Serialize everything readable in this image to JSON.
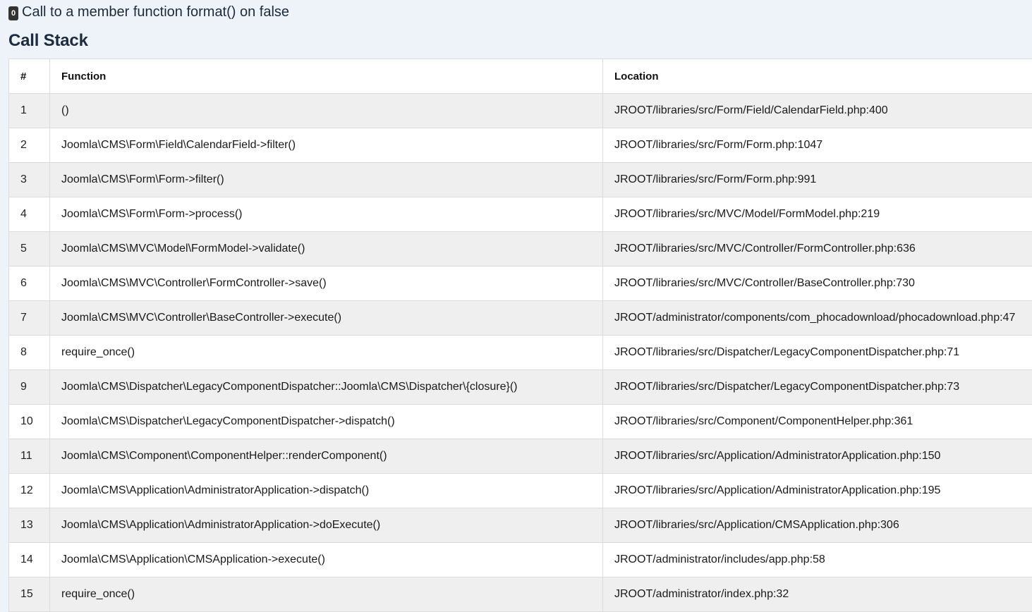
{
  "error": {
    "badge": "0",
    "message": "Call to a member function format() on false"
  },
  "call_stack": {
    "title": "Call Stack",
    "columns": [
      "#",
      "Function",
      "Location"
    ],
    "rows": [
      {
        "num": "1",
        "function": "()",
        "location": "JROOT/libraries/src/Form/Field/CalendarField.php:400"
      },
      {
        "num": "2",
        "function": "Joomla\\CMS\\Form\\Field\\CalendarField->filter()",
        "location": "JROOT/libraries/src/Form/Form.php:1047"
      },
      {
        "num": "3",
        "function": "Joomla\\CMS\\Form\\Form->filter()",
        "location": "JROOT/libraries/src/Form/Form.php:991"
      },
      {
        "num": "4",
        "function": "Joomla\\CMS\\Form\\Form->process()",
        "location": "JROOT/libraries/src/MVC/Model/FormModel.php:219"
      },
      {
        "num": "5",
        "function": "Joomla\\CMS\\MVC\\Model\\FormModel->validate()",
        "location": "JROOT/libraries/src/MVC/Controller/FormController.php:636"
      },
      {
        "num": "6",
        "function": "Joomla\\CMS\\MVC\\Controller\\FormController->save()",
        "location": "JROOT/libraries/src/MVC/Controller/BaseController.php:730"
      },
      {
        "num": "7",
        "function": "Joomla\\CMS\\MVC\\Controller\\BaseController->execute()",
        "location": "JROOT/administrator/components/com_phocadownload/phocadownload.php:47"
      },
      {
        "num": "8",
        "function": "require_once()",
        "location": "JROOT/libraries/src/Dispatcher/LegacyComponentDispatcher.php:71"
      },
      {
        "num": "9",
        "function": "Joomla\\CMS\\Dispatcher\\LegacyComponentDispatcher::Joomla\\CMS\\Dispatcher\\{closure}()",
        "location": "JROOT/libraries/src/Dispatcher/LegacyComponentDispatcher.php:73"
      },
      {
        "num": "10",
        "function": "Joomla\\CMS\\Dispatcher\\LegacyComponentDispatcher->dispatch()",
        "location": "JROOT/libraries/src/Component/ComponentHelper.php:361"
      },
      {
        "num": "11",
        "function": "Joomla\\CMS\\Component\\ComponentHelper::renderComponent()",
        "location": "JROOT/libraries/src/Application/AdministratorApplication.php:150"
      },
      {
        "num": "12",
        "function": "Joomla\\CMS\\Application\\AdministratorApplication->dispatch()",
        "location": "JROOT/libraries/src/Application/AdministratorApplication.php:195"
      },
      {
        "num": "13",
        "function": "Joomla\\CMS\\Application\\AdministratorApplication->doExecute()",
        "location": "JROOT/libraries/src/Application/CMSApplication.php:306"
      },
      {
        "num": "14",
        "function": "Joomla\\CMS\\Application\\CMSApplication->execute()",
        "location": "JROOT/administrator/includes/app.php:58"
      },
      {
        "num": "15",
        "function": "require_once()",
        "location": "JROOT/administrator/index.php:32"
      }
    ]
  }
}
